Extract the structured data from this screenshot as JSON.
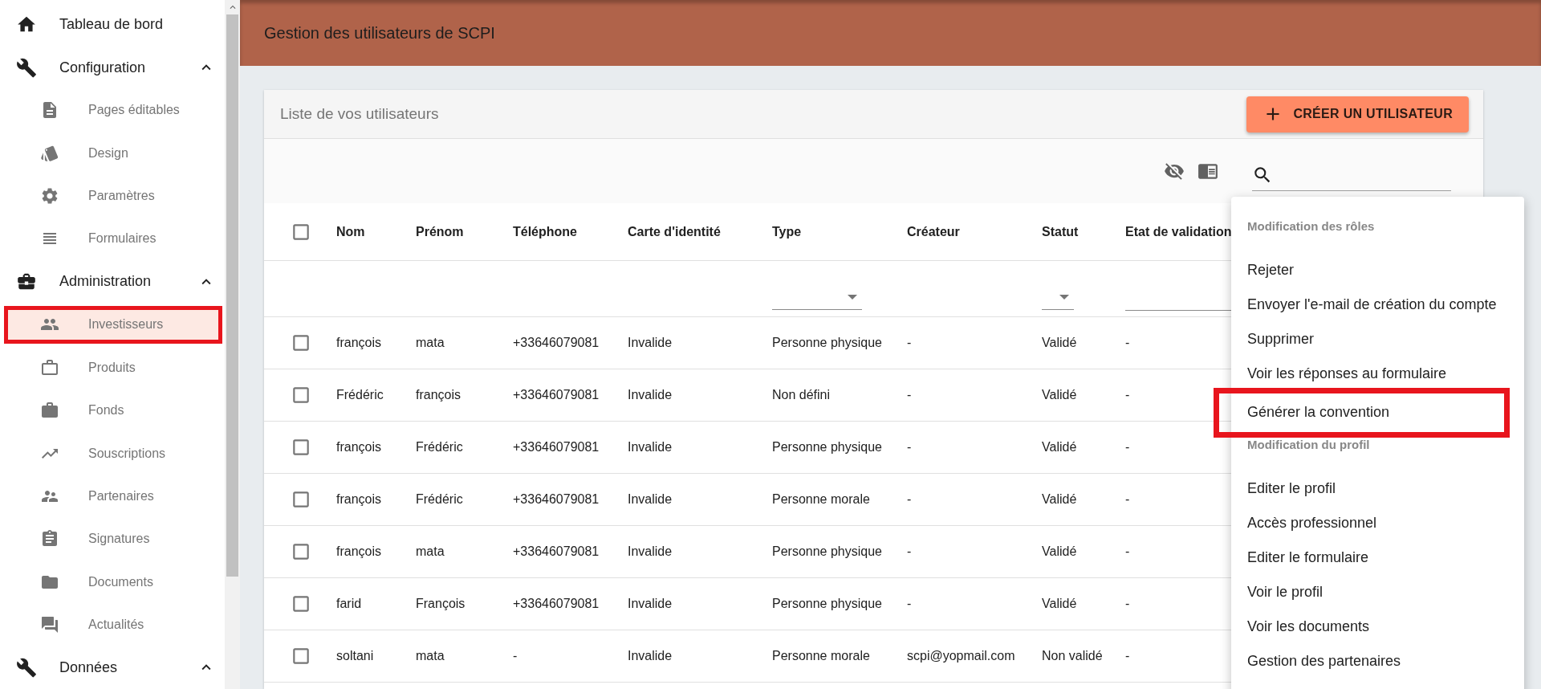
{
  "sidebar": {
    "items": [
      {
        "label": "Tableau de bord",
        "kind": "link",
        "selected": false,
        "annotated": false
      },
      {
        "label": "Configuration",
        "kind": "section",
        "expanded": true,
        "selected": false,
        "annotated": false,
        "children": [
          {
            "label": "Pages éditables",
            "selected": false,
            "annotated": false
          },
          {
            "label": "Design",
            "selected": false,
            "annotated": false
          },
          {
            "label": "Paramètres",
            "selected": false,
            "annotated": false
          },
          {
            "label": "Formulaires",
            "selected": false,
            "annotated": false
          }
        ]
      },
      {
        "label": "Administration",
        "kind": "section",
        "expanded": true,
        "selected": false,
        "annotated": false,
        "children": [
          {
            "label": "Investisseurs",
            "selected": true,
            "annotated": true
          },
          {
            "label": "Produits",
            "selected": false,
            "annotated": false
          },
          {
            "label": "Fonds",
            "selected": false,
            "annotated": false
          },
          {
            "label": "Souscriptions",
            "selected": false,
            "annotated": false
          },
          {
            "label": "Partenaires",
            "selected": false,
            "annotated": false
          },
          {
            "label": "Signatures",
            "selected": false,
            "annotated": false
          },
          {
            "label": "Documents",
            "selected": false,
            "annotated": false
          },
          {
            "label": "Actualités",
            "selected": false,
            "annotated": false
          }
        ]
      },
      {
        "label": "Données",
        "kind": "section",
        "expanded": true,
        "selected": false,
        "annotated": false
      }
    ]
  },
  "header": {
    "title": "Gestion des utilisateurs de SCPI"
  },
  "card": {
    "title": "Liste de vos utilisateurs",
    "create_button": "CRÉER UN UTILISATEUR"
  },
  "table": {
    "columns": [
      {
        "label": "Nom",
        "dropdown_filter": false,
        "text_filter": false
      },
      {
        "label": "Prénom",
        "dropdown_filter": false,
        "text_filter": false
      },
      {
        "label": "Téléphone",
        "dropdown_filter": false,
        "text_filter": false
      },
      {
        "label": "Carte d'identité",
        "dropdown_filter": false,
        "text_filter": false
      },
      {
        "label": "Type",
        "dropdown_filter": true,
        "text_filter": false
      },
      {
        "label": "Créateur",
        "dropdown_filter": false,
        "text_filter": false
      },
      {
        "label": "Statut",
        "dropdown_filter": true,
        "text_filter": false
      },
      {
        "label": "Etat de validation",
        "dropdown_filter": false,
        "text_filter": true
      }
    ],
    "all_checked": false,
    "rows": [
      {
        "checked": false,
        "cells": [
          "françois",
          "mata",
          "+33646079081",
          "Invalide",
          "Personne physique",
          "-",
          "Validé",
          "-"
        ]
      },
      {
        "checked": false,
        "cells": [
          "Frédéric",
          "françois",
          "+33646079081",
          "Invalide",
          "Non défini",
          "-",
          "Validé",
          "-"
        ]
      },
      {
        "checked": false,
        "cells": [
          "françois",
          "Frédéric",
          "+33646079081",
          "Invalide",
          "Personne physique",
          "-",
          "Validé",
          "-"
        ]
      },
      {
        "checked": false,
        "cells": [
          "françois",
          "Frédéric",
          "+33646079081",
          "Invalide",
          "Personne morale",
          "-",
          "Validé",
          "-"
        ]
      },
      {
        "checked": false,
        "cells": [
          "françois",
          "mata",
          "+33646079081",
          "Invalide",
          "Personne physique",
          "-",
          "Validé",
          "-"
        ]
      },
      {
        "checked": false,
        "cells": [
          "farid",
          "François",
          "+33646079081",
          "Invalide",
          "Personne physique",
          "-",
          "Validé",
          "-"
        ]
      },
      {
        "checked": false,
        "cells": [
          "soltani",
          "mata",
          "-",
          "Invalide",
          "Personne morale",
          "scpi@yopmail.com",
          "Non validé",
          "-"
        ]
      }
    ]
  },
  "menu": {
    "items": [
      {
        "kind": "header",
        "label": "Modification des rôles"
      },
      {
        "kind": "item",
        "label": "Rejeter",
        "annotated": false
      },
      {
        "kind": "item",
        "label": "Envoyer l'e-mail de création du compte",
        "annotated": false
      },
      {
        "kind": "item",
        "label": "Supprimer",
        "annotated": false
      },
      {
        "kind": "item",
        "label": "Voir les réponses au formulaire",
        "annotated": false
      },
      {
        "kind": "item",
        "label": "Générer la convention",
        "annotated": true
      },
      {
        "kind": "header",
        "label": "Modification du profil"
      },
      {
        "kind": "item",
        "label": "Editer le profil",
        "annotated": false
      },
      {
        "kind": "item",
        "label": "Accès professionnel",
        "annotated": false
      },
      {
        "kind": "item",
        "label": "Editer le formulaire",
        "annotated": false
      },
      {
        "kind": "item",
        "label": "Voir le profil",
        "annotated": false
      },
      {
        "kind": "item",
        "label": "Voir les documents",
        "annotated": false
      },
      {
        "kind": "item",
        "label": "Gestion des partenaires",
        "annotated": false
      }
    ]
  }
}
